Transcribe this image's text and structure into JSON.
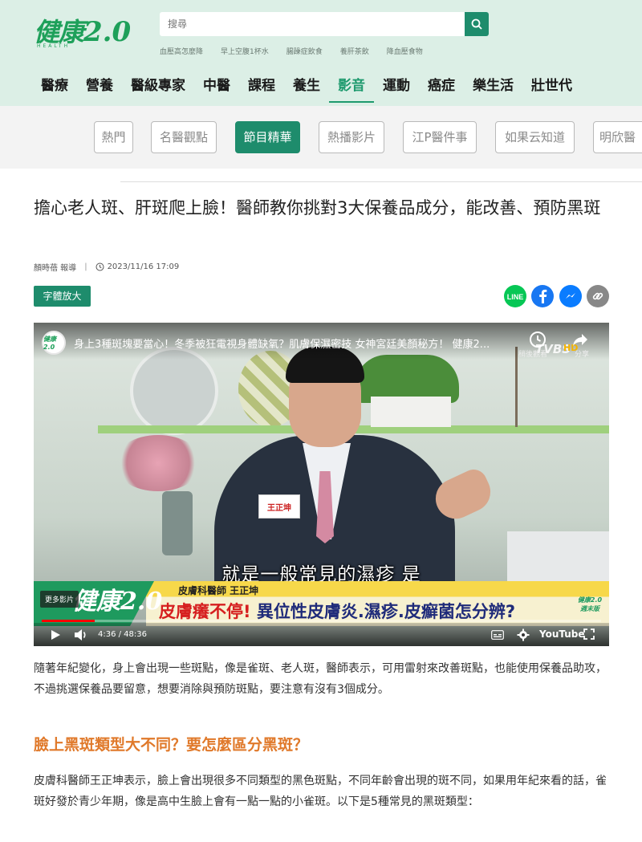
{
  "header": {
    "logo_text": "健康",
    "logo_num": "2.0",
    "logo_sub": "HEALTH",
    "search": {
      "placeholder": "搜尋"
    },
    "hot_tags": [
      "血壓高怎麼降",
      "早上空腹1杯水",
      "腸躁症飲食",
      "養肝茶飲",
      "降血壓食物"
    ],
    "nav": [
      "醫療",
      "營養",
      "醫級專家",
      "中醫",
      "課程",
      "養生",
      "影音",
      "運動",
      "癌症",
      "樂生活",
      "壯世代"
    ],
    "active_nav": "影音"
  },
  "subnav": {
    "chips": [
      "熱門",
      "名醫觀點",
      "節目精華",
      "熱播影片",
      "江P醫件事",
      "如果云知道",
      "明欣醫"
    ],
    "active": "節目精華"
  },
  "article": {
    "title": "擔心老人斑、肝斑爬上臉！醫師教你挑對3大保養品成分，能改善、預防黑斑",
    "author": "顏時蓓 報導",
    "date": "2023/11/16 17:09",
    "font_button": "字體放大",
    "share": [
      "LINE",
      "facebook",
      "messenger",
      "copy-link"
    ],
    "intro": "隨著年紀變化，身上會出現一些斑點，像是雀斑、老人斑，醫師表示，可用雷射來改善斑點，也能使用保養品助攻，不過挑選保養品要留意，想要消除與預防斑點，要注意有沒有3個成分。",
    "heading": "臉上黑斑類型大不同？要怎麼區分黑斑？",
    "para2": "皮膚科醫師王正坤表示，臉上會出現很多不同類型的黑色斑點，不同年齡會出現的斑不同，如果用年紀來看的話，雀斑好發於青少年期，像是高中生臉上會有一點一點的小雀斑。以下是5種常見的黑斑類型："
  },
  "video": {
    "title": "身上3種斑塊要當心！冬季被狂電視身體缺氧？肌膚保濕密技 女神宮廷美顏秘方！ 健康2...",
    "clock_label": "稍後觀看",
    "share_label": "分享",
    "channel_mark": "TVBS",
    "hd_mark": "HD",
    "avatar_text": "健康2.0",
    "nametag": "王正坤",
    "subtitle": "就是一般常見的濕疹 是",
    "lower_logo": "健康2.0",
    "doctor": "皮膚科醫師 王正坤",
    "headline_red": "皮膚癢不停!",
    "headline_blue": " 異位性皮膚炎.濕疹.皮癬菌怎分辨?",
    "badge": "健康2.0 週末版",
    "more_videos": "更多影片",
    "time": "4:36 / 48:36",
    "progress": 0.095,
    "youtube": "YouTube"
  },
  "colors": {
    "brand_green": "#1e8c6c",
    "header_bg": "#dcefe6",
    "heading_orange": "#e0792a",
    "line_green": "#06c755",
    "facebook_blue": "#1877f2",
    "messenger_blue": "#0a7cff",
    "link_grey": "#888888"
  }
}
